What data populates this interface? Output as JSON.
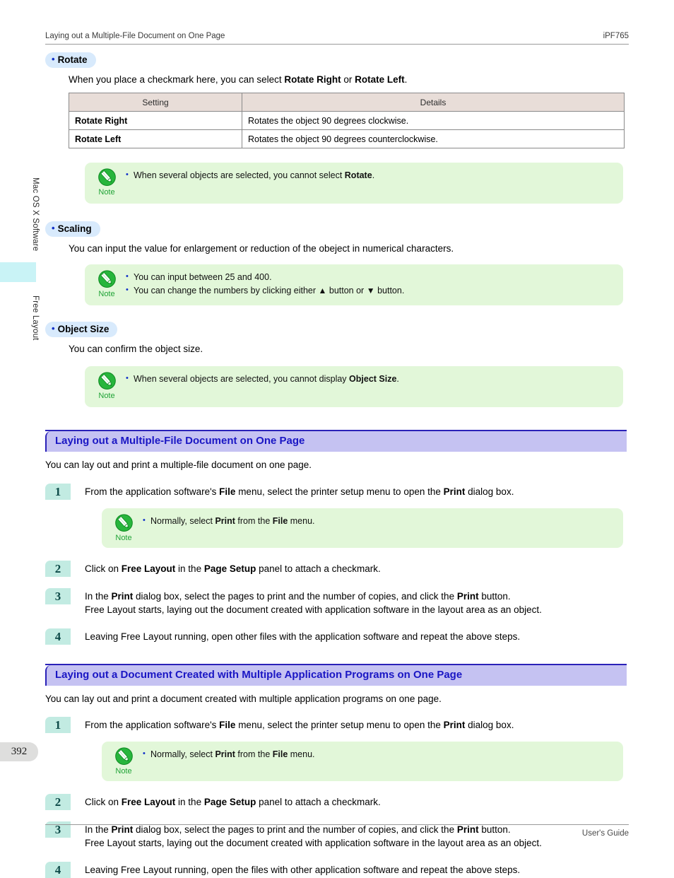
{
  "header": {
    "left": "Laying out a Multiple-File Document on One Page",
    "right": "iPF765"
  },
  "footer": {
    "right": "User's Guide"
  },
  "side_tabs": {
    "chapter": "Mac OS X Software",
    "section": "Free Layout",
    "page_number": "392"
  },
  "colors": {
    "pill_bg": "#d8eafc",
    "bullet_blue": "#1130c8",
    "note_bg": "#e2f7d9",
    "note_green": "#20a336",
    "section_bar_bg": "#c5c2f2",
    "section_bar_text": "#1a16c4",
    "section_rule": "#2a22b8",
    "step_badge_bg": "#c2ebe2",
    "step_badge_text": "#0d4a48",
    "table_header_bg": "#e8ddd8",
    "page_box_bg": "#dededd",
    "side_marker": "#c9f3f6"
  },
  "rotate_section": {
    "pill_label": "Rotate",
    "description_pre": "When you place a checkmark here, you can select ",
    "description_b1": "Rotate Right",
    "description_mid": " or ",
    "description_b2": "Rotate Left",
    "description_post": ".",
    "table": {
      "headers": [
        "Setting",
        "Details"
      ],
      "rows": [
        {
          "setting": "Rotate Right",
          "details": "Rotates the object 90 degrees clockwise."
        },
        {
          "setting": "Rotate Left",
          "details": "Rotates the object 90 degrees counterclockwise."
        }
      ]
    },
    "note": {
      "caption": "Note",
      "icon": "note-pencil-icon",
      "items_pre": [
        "When several objects are selected, you cannot select "
      ],
      "items_b": [
        "Rotate"
      ],
      "items_post": [
        "."
      ]
    }
  },
  "scaling_section": {
    "pill_label": "Scaling",
    "description": "You can input the value for enlargement or reduction of the obeject in numerical characters.",
    "note": {
      "caption": "Note",
      "icon": "note-pencil-icon",
      "item1": "You can input between 25 and 400.",
      "item2_pre": "You can change the numbers by clicking either ",
      "item2_up": "▲",
      "item2_mid": " button or ",
      "item2_down": "▼",
      "item2_post": " button."
    }
  },
  "object_size_section": {
    "pill_label": "Object Size",
    "description": "You can confirm the object size.",
    "note": {
      "caption": "Note",
      "icon": "note-pencil-icon",
      "item_pre": "When several objects are selected, you cannot display ",
      "item_b": "Object Size",
      "item_post": "."
    }
  },
  "section_a": {
    "heading": "Laying out a Multiple-File Document on One Page",
    "intro": "You can lay out and print a multiple-file document on one page.",
    "steps": [
      {
        "number": "1",
        "parts": [
          "From the application software's ",
          "File",
          " menu, select the printer setup menu to open the ",
          "Print",
          " dialog box."
        ]
      },
      {
        "number": "2",
        "parts": [
          "Click on ",
          "Free Layout",
          " in the ",
          "Page Setup",
          " panel to attach a checkmark."
        ]
      },
      {
        "number": "3",
        "line1_parts": [
          "In the ",
          "Print",
          " dialog box, select the pages to print and the number of copies, and click the ",
          "Print",
          " button."
        ],
        "line2": "Free Layout starts, laying out the document created with application software in the layout area as an object."
      },
      {
        "number": "4",
        "text": "Leaving Free Layout running, open other files with the application software and repeat the above steps."
      }
    ],
    "step1_note": {
      "caption": "Note",
      "icon": "note-pencil-icon",
      "parts": [
        "Normally, select ",
        "Print",
        " from the ",
        "File",
        " menu."
      ]
    }
  },
  "section_b": {
    "heading": "Laying out a Document Created with Multiple Application Programs on One Page",
    "intro": "You can lay out and print a document created with multiple application programs on one page.",
    "steps": [
      {
        "number": "1",
        "parts": [
          "From the application software's ",
          "File",
          " menu, select the printer setup menu to open the ",
          "Print",
          " dialog box."
        ]
      },
      {
        "number": "2",
        "parts": [
          "Click on ",
          "Free Layout",
          " in the ",
          "Page Setup",
          " panel to attach a checkmark."
        ]
      },
      {
        "number": "3",
        "line1_parts": [
          "In the ",
          "Print",
          " dialog box, select the pages to print and the number of copies, and click the ",
          "Print",
          " button."
        ],
        "line2": "Free Layout starts, laying out the document created with application software in the layout area as an object."
      },
      {
        "number": "4",
        "text": "Leaving Free Layout running, open the files with other application software and repeat the above steps."
      }
    ],
    "step1_note": {
      "caption": "Note",
      "icon": "note-pencil-icon",
      "parts": [
        "Normally, select ",
        "Print",
        " from the ",
        "File",
        " menu."
      ]
    }
  }
}
